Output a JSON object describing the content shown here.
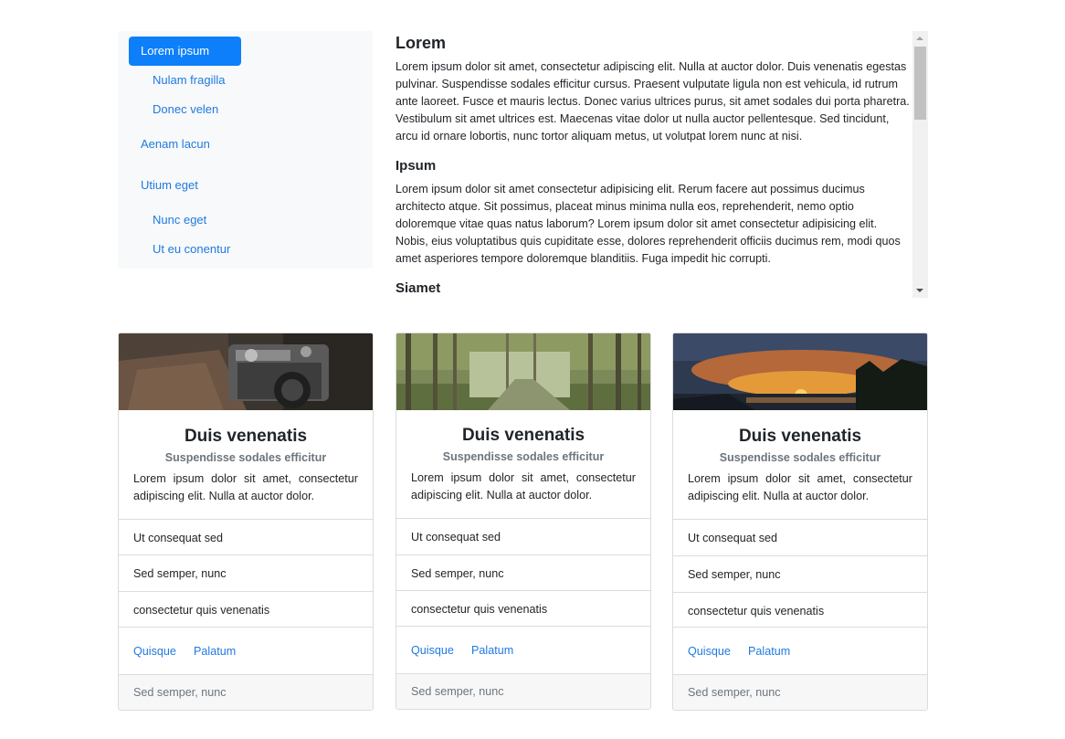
{
  "sidebar": {
    "items": [
      {
        "label": "Lorem ipsum",
        "active": true
      },
      {
        "label": "Nulam fragilla"
      },
      {
        "label": "Donec velen"
      },
      {
        "label": "Aenam lacun"
      },
      {
        "label": "Utium eget"
      },
      {
        "label": "Nunc eget"
      },
      {
        "label": "Ut eu conentur"
      }
    ]
  },
  "content": {
    "sections": [
      {
        "heading": "Lorem",
        "text": "Lorem ipsum dolor sit amet, consectetur adipiscing elit. Nulla at auctor dolor. Duis venenatis egestas pulvinar. Suspendisse sodales efficitur cursus. Praesent vulputate ligula non est vehicula, id rutrum ante laoreet. Fusce et mauris lectus. Donec varius ultrices purus, sit amet sodales dui porta pharetra. Vestibulum sit amet ultrices est. Maecenas vitae dolor ut nulla auctor pellentesque. Sed tincidunt, arcu id ornare lobortis, nunc tortor aliquam metus, ut volutpat lorem nunc at nisi."
      },
      {
        "heading": "Ipsum",
        "text": "Lorem ipsum dolor sit amet consectetur adipisicing elit. Rerum facere aut possimus ducimus architecto atque. Sit possimus, placeat minus minima nulla eos, reprehenderit, nemo optio doloremque vitae quas natus laborum? Lorem ipsum dolor sit amet consectetur adipisicing elit. Nobis, eius voluptatibus quis cupiditate esse, dolores reprehenderit officiis ducimus rem, modi quos amet asperiores tempore doloremque blanditiis. Fuga impedit hic corrupti."
      },
      {
        "heading": "Siamet"
      }
    ]
  },
  "cards": [
    {
      "image": "camera-photo",
      "title": "Duis venenatis",
      "subtitle": "Suspendisse sodales efficitur",
      "text": "Lorem ipsum dolor sit amet, consectetur adipiscing elit. Nulla at auctor dolor.",
      "list": [
        "Ut consequat sed",
        "Sed semper, nunc",
        "consectetur quis venenatis"
      ],
      "links": [
        "Quisque",
        "Palatum"
      ],
      "footer": "Sed semper, nunc"
    },
    {
      "image": "forest-photo",
      "title": "Duis venenatis",
      "subtitle": "Suspendisse sodales efficitur",
      "text": "Lorem ipsum dolor sit amet, consectetur adipiscing elit. Nulla at auctor dolor.",
      "list": [
        "Ut consequat sed",
        "Sed semper, nunc",
        "consectetur quis venenatis"
      ],
      "links": [
        "Quisque",
        "Palatum"
      ],
      "footer": "Sed semper, nunc"
    },
    {
      "image": "sunset-photo",
      "title": "Duis venenatis",
      "subtitle": "Suspendisse sodales efficitur",
      "text": "Lorem ipsum dolor sit amet, consectetur adipiscing elit. Nulla at auctor dolor.",
      "list": [
        "Ut consequat sed",
        "Sed semper, nunc",
        "consectetur quis venenatis"
      ],
      "links": [
        "Quisque",
        "Palatum"
      ],
      "footer": "Sed semper, nunc"
    }
  ],
  "colors": {
    "primary": "#0d7ffb",
    "link": "#1f7ae0",
    "muted": "#6c757d",
    "nav_bg": "#f8f9fa",
    "border": "#dcdcdc"
  }
}
